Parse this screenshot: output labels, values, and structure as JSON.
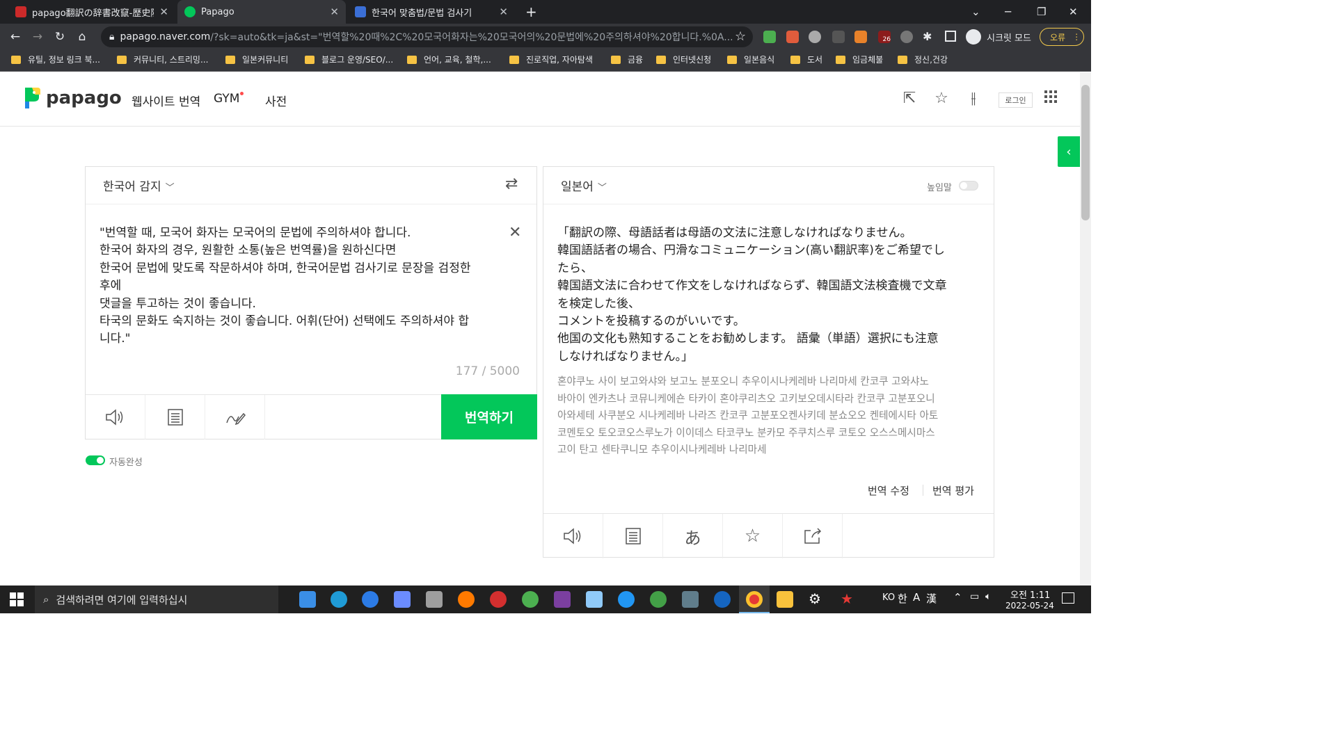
{
  "tabs": [
    {
      "title": "papago翻訳の辞書改竄-歴史隠蔽",
      "color": "#cc2a2a",
      "active": false
    },
    {
      "title": "Papago",
      "color": "#03c75a",
      "active": true
    },
    {
      "title": "한국어 맞춤법/문법 검사기",
      "color": "#3b6fd6",
      "active": false
    }
  ],
  "new_tab": "+",
  "address": {
    "host": "papago.naver.com",
    "path": "/?sk=auto&tk=ja&st=\"번역할%20때%2C%20모국어화자는%20모국어의%20문법에%20주의하셔야%20합니다.%0A..."
  },
  "profile_label": "시크릿 모드",
  "error_label": "오류",
  "ext_badge": "26",
  "bookmarks": [
    "유틸, 정보 링크 북...",
    "커뮤니티, 스트리밍...",
    "일본커뮤니티",
    "블로그 운영/SEO/...",
    "언어, 교육, 철학,...",
    "진로직업, 자아탐색",
    "금융",
    "인터넷신청",
    "일본음식",
    "도서",
    "임금체불",
    "정신,건강"
  ],
  "header": {
    "logo": "papago",
    "nav": [
      "웹사이트 번역",
      "GYM",
      "사전"
    ],
    "login": "로그인"
  },
  "source": {
    "lang": "한국어 감지",
    "text": "\"번역할 때, 모국어 화자는 모국어의 문법에 주의하셔야 합니다.\n한국어 화자의 경우, 원활한 소통(높은 번역률)을 원하신다면\n한국어 문법에 맞도록 작문하셔야 하며, 한국어문법 검사기로 문장을 검정한\n후에\n댓글을 투고하는 것이 좋습니다.\n타국의 문화도 숙지하는 것이 좋습니다. 어휘(단어) 선택에도 주의하셔야 합\n니다.\"",
    "counter": "177 / 5000",
    "translate_btn": "번역하기",
    "autocomplete": "자동완성"
  },
  "target": {
    "lang": "일본어",
    "honorific": "높임말",
    "text": "「翻訳の際、母語話者は母語の文法に注意しなければなりません。\n韓国語話者の場合、円滑なコミュニケーション(高い翻訳率)をご希望でし\nたら、\n韓国語文法に合わせて作文をしなければならず、韓国語文法検査機で文章\nを検定した後、\nコメントを投稿するのがいいです。\n他国の文化も熟知することをお勧めします。 語彙（単語）選択にも注意\nしなければなりません。」",
    "pronunciation": "혼야쿠노 사이 보고와샤와 보고노 분포오니 추우이시나케레바 나리마세 칸코쿠 고와샤노\n바아이 엔카츠나 코뮤니케에숀 타카이 혼야쿠리츠오 고키보오데시타라 칸코쿠 고분포오니\n아와세테 사쿠분오 시나케레바 나라즈 칸코쿠 고분포오켄사키데 분쇼오오 켄테에시타 아토\n코멘토오 토오코오스루노가 이이데스 타코쿠노 분카모 주쿠치스루 코토오 오스스메시마스\n고이 탄고 센타쿠니모 추우이시나케레바 나리마세",
    "edit": "번역 수정",
    "rate": "번역 평가"
  },
  "taskbar": {
    "search_placeholder": "검색하려면 여기에 입력하십시",
    "ime": [
      "KO",
      "한",
      "A",
      "漢"
    ],
    "time": "오전 1:11",
    "date": "2022-05-24"
  },
  "colors": {
    "accent": "#03c75a",
    "chrome_dark": "#202124",
    "chrome_mid": "#35363a"
  }
}
